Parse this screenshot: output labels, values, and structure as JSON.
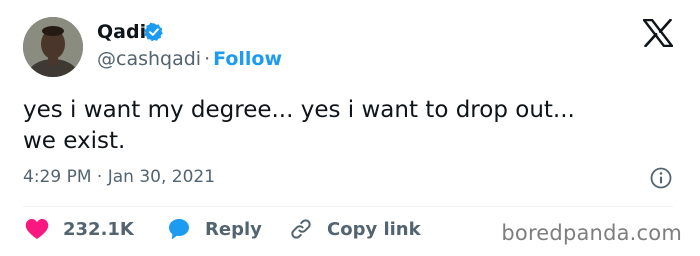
{
  "author": {
    "name": "Qadi",
    "handle": "@cashqadi",
    "separator": "·",
    "follow_label": "Follow",
    "verified_icon": "verified-badge-icon",
    "avatar_icon": "profile-photo"
  },
  "tweet": {
    "lines": [
      "yes i want my degree... yes i want to drop out...",
      "we exist."
    ],
    "timestamp": "4:29 PM · Jan 30, 2021"
  },
  "actions": {
    "likes": "232.1K",
    "reply_label": "Reply",
    "copy_link_label": "Copy link"
  },
  "icons": {
    "x_logo": "x-logo-icon",
    "info": "info-icon",
    "like": "heart-icon",
    "reply": "reply-bubble-icon",
    "link": "link-icon"
  },
  "watermark": "boredpanda.com",
  "colors": {
    "text": "#0f1419",
    "secondary": "#536471",
    "accent": "#1d9bf0",
    "like": "#f91880",
    "divider": "#eff3f4",
    "watermark": "#7e7e7e"
  }
}
